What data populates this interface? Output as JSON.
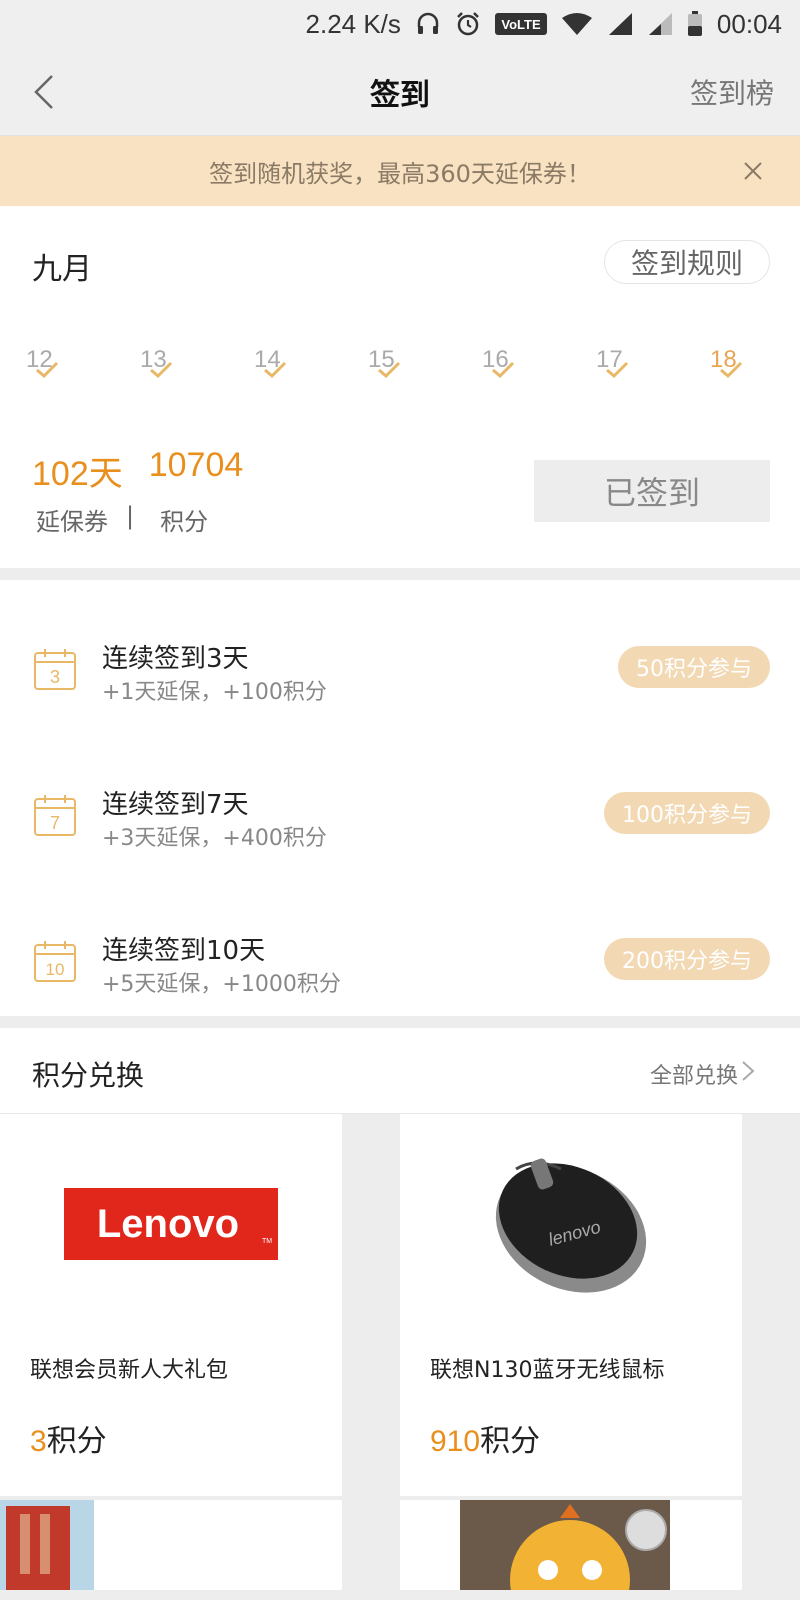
{
  "status": {
    "speed": "2.24 K/s",
    "time": "00:04",
    "volte": "VoLTE"
  },
  "nav": {
    "title": "签到",
    "right": "签到榜"
  },
  "banner": {
    "text": "签到随机获奖，最高360天延保券！"
  },
  "sign": {
    "month": "九月",
    "rules": "签到规则",
    "days": [
      "12",
      "13",
      "14",
      "15",
      "16",
      "17",
      "18"
    ],
    "warranty_days": "102天",
    "points": "10704",
    "warranty_label": "延保券",
    "separator": "|",
    "points_label": "积分",
    "signed_button": "已签到"
  },
  "tasks": [
    {
      "icon_num": "3",
      "title": "连续签到3天",
      "desc": "+1天延保，+100积分",
      "button": "50积分参与"
    },
    {
      "icon_num": "7",
      "title": "连续签到7天",
      "desc": "+3天延保，+400积分",
      "button": "100积分参与"
    },
    {
      "icon_num": "10",
      "title": "连续签到10天",
      "desc": "+5天延保，+1000积分",
      "button": "200积分参与"
    }
  ],
  "exchange": {
    "title": "积分兑换",
    "all": "全部兑换",
    "products": [
      {
        "name": "联想会员新人大礼包",
        "price": "3",
        "unit": "积分",
        "logo_text": "Lenovo"
      },
      {
        "name": "联想N130蓝牙无线鼠标",
        "price": "910",
        "unit": "积分",
        "mouse_text": "lenovo"
      }
    ]
  },
  "colors": {
    "accent": "#e88f1e",
    "banner_bg": "#f8e2c1",
    "join_bg": "#f2d9b4",
    "lenovo_red": "#e1261c"
  }
}
